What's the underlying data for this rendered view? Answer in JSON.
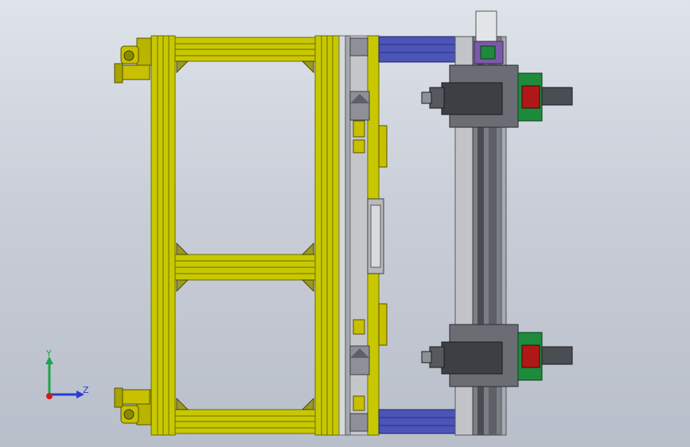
{
  "viewport": {
    "background_top": "#dfe3ea",
    "background_bottom": "#b9bfca"
  },
  "colors": {
    "frame_yellow": "#c8c800",
    "frame_yellow_dark": "#7a7a00",
    "rail_blue": "#4b55b8",
    "steel": "#8d9096",
    "steel_dark": "#3d3f44",
    "motor_green": "#1e8a3c",
    "plate_grey": "#6a6d73",
    "purple_block": "#7a5aa8"
  },
  "triad": {
    "y_label": "Y",
    "z_label": "Z",
    "y_color": "#1ea44a",
    "z_color": "#2a3bd8",
    "x_color": "#d21a1a"
  }
}
